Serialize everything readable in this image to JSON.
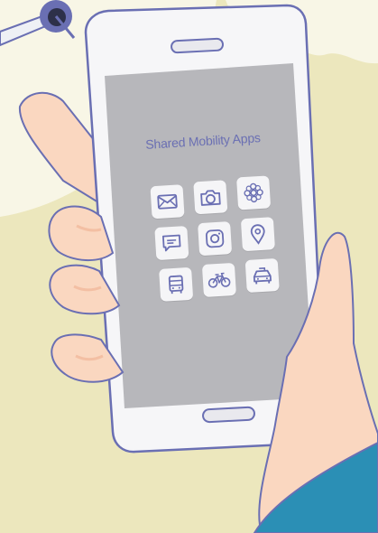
{
  "screen": {
    "title": "Shared Mobility Apps"
  },
  "apps": [
    {
      "icon": "mail-icon"
    },
    {
      "icon": "camera-icon"
    },
    {
      "icon": "flower-icon"
    },
    {
      "icon": "chat-icon"
    },
    {
      "icon": "instagram-icon"
    },
    {
      "icon": "location-pin-icon"
    },
    {
      "icon": "bus-icon"
    },
    {
      "icon": "bicycle-icon"
    },
    {
      "icon": "taxi-icon"
    }
  ],
  "colors": {
    "background": "#ece7bd",
    "phone_frame": "#f6f6f8",
    "phone_outline": "#6a6fb3",
    "screen": "#b7b7bb",
    "icon_stroke": "#6a6fb3",
    "skin": "#fad7c0",
    "sleeve": "#2b8fb5"
  }
}
